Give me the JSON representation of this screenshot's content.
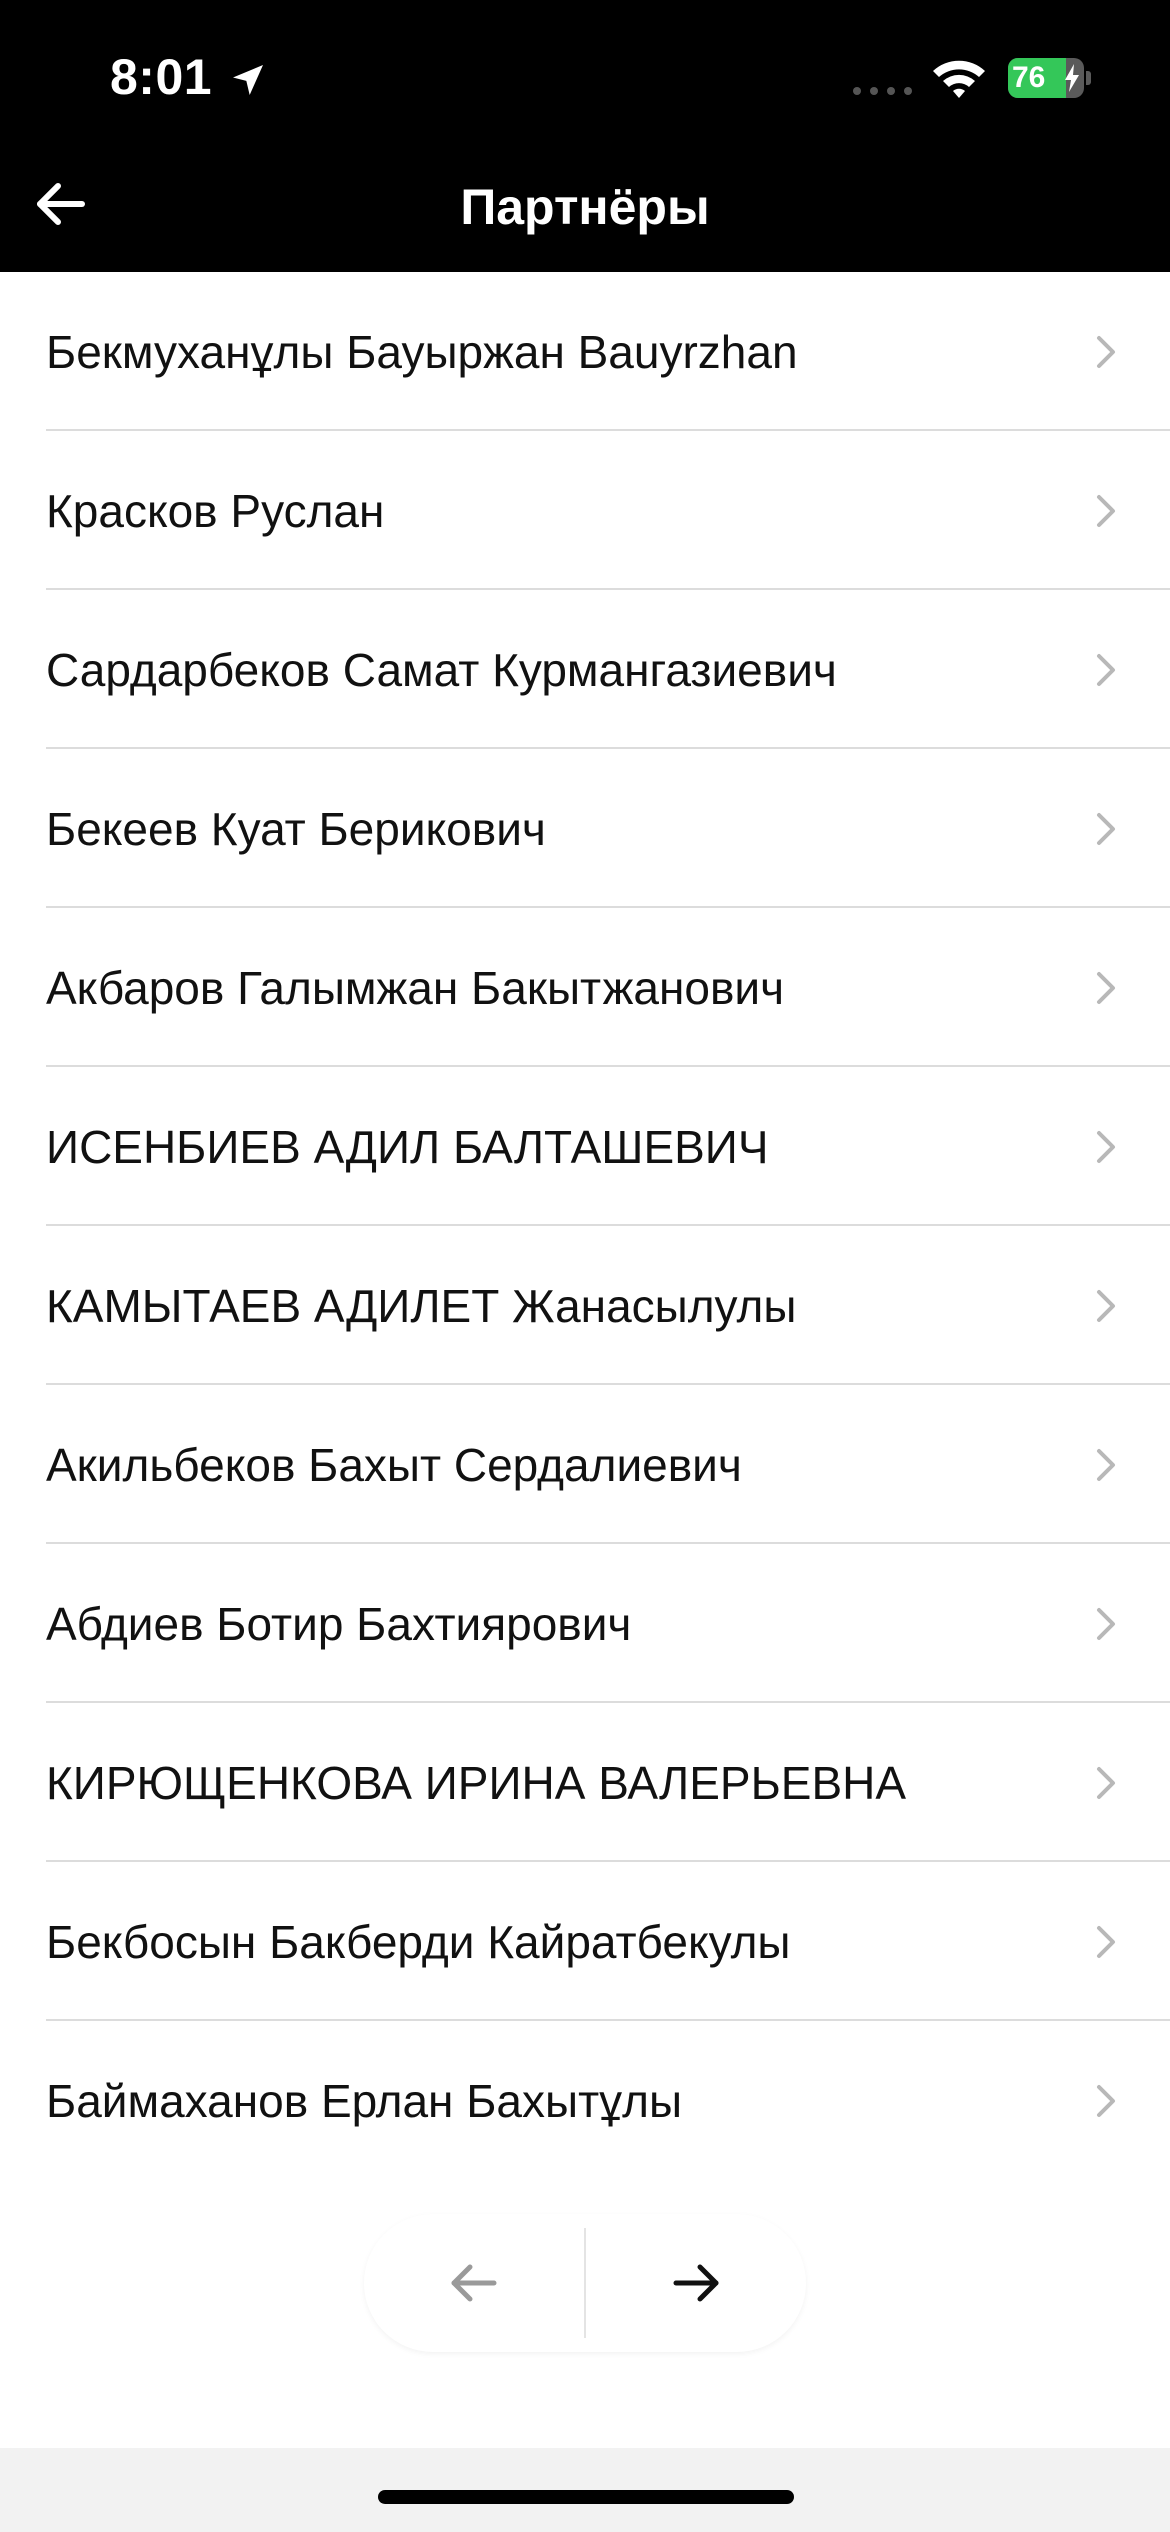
{
  "status_bar": {
    "time": "8:01",
    "battery_level": "76",
    "battery_percent": 76,
    "battery_color": "#34c759"
  },
  "header": {
    "title": "Партнёры",
    "back_icon": "arrow-left-icon"
  },
  "partners": [
    "Бекмуханұлы Бауыржан Bauyrzhan",
    "Красков Руслан",
    "Сардарбеков Самат Курмангазиевич",
    "Бекеев Куат Берикович",
    "Акбаров Галымжан Бакытжанович",
    "ИСЕНБИЕВ АДИЛ БАЛТАШЕВИЧ",
    "КАМЫТАЕВ АДИЛЕТ Жанасылулы",
    "Акильбеков Бахыт Сердалиевич",
    "Абдиев Ботир Бахтиярович",
    "КИРЮЩЕНКОВА ИРИНА ВАЛЕРЬЕВНА",
    "Бекбосын Бакберди Кайратбекулы",
    "Баймаханов Ерлан Бахытұлы"
  ],
  "pager": {
    "prev_icon": "arrow-left-icon",
    "next_icon": "arrow-right-icon",
    "prev_enabled": false,
    "next_enabled": true
  }
}
